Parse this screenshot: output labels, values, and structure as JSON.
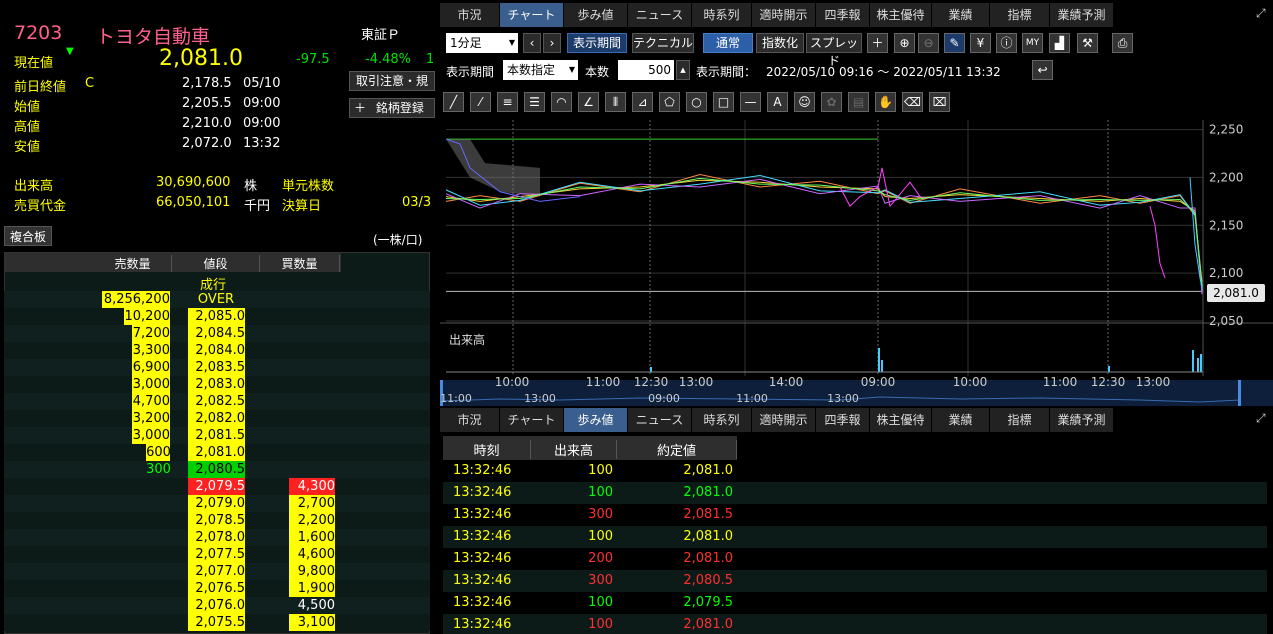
{
  "stock": {
    "code": "7203",
    "name": "トヨタ自動車",
    "market": "東証Ｐ",
    "current_label": "現在値",
    "current_price": "2,081.0",
    "change": "-97.5",
    "change_pct": "-4.48%",
    "change_trail": "1",
    "rows": [
      {
        "label": "前日終値",
        "flag": "C",
        "value": "2,178.5",
        "time": "05/10"
      },
      {
        "label": "始値",
        "value": "2,205.5",
        "time": "09:00"
      },
      {
        "label": "高値",
        "value": "2,210.0",
        "time": "09:00"
      },
      {
        "label": "安値",
        "value": "2,072.0",
        "time": "13:32"
      }
    ],
    "volume_label": "出来高",
    "volume": "30,690,600",
    "volume_unit": "株",
    "unit_shares_label": "単元株数",
    "turnover_label": "売買代金",
    "turnover": "66,050,101",
    "turnover_unit": "千円",
    "settlement_label": "決算日",
    "settlement_value": "03/3",
    "btn_notice": "取引注意・規",
    "btn_register": "銘柄登録",
    "btn_register_icon": "＋"
  },
  "orderbook": {
    "panel_label": "複合板",
    "unit_label": "(一株/口)",
    "headers": [
      "売数量",
      "値段",
      "買数量"
    ],
    "market_label": "成行",
    "rows": [
      {
        "sell": "8,256,200",
        "price": "OVER",
        "buy": "",
        "kind": "over"
      },
      {
        "sell": "10,200",
        "price": "2,085.0",
        "buy": "",
        "kind": "sell"
      },
      {
        "sell": "7,200",
        "price": "2,084.5",
        "buy": "",
        "kind": "sell"
      },
      {
        "sell": "3,300",
        "price": "2,084.0",
        "buy": "",
        "kind": "sell"
      },
      {
        "sell": "6,900",
        "price": "2,083.5",
        "buy": "",
        "kind": "sell"
      },
      {
        "sell": "3,000",
        "price": "2,083.0",
        "buy": "",
        "kind": "sell"
      },
      {
        "sell": "4,700",
        "price": "2,082.5",
        "buy": "",
        "kind": "sell"
      },
      {
        "sell": "3,200",
        "price": "2,082.0",
        "buy": "",
        "kind": "sell"
      },
      {
        "sell": "3,000",
        "price": "2,081.5",
        "buy": "",
        "kind": "sell"
      },
      {
        "sell": "600",
        "price": "2,081.0",
        "buy": "",
        "kind": "sell"
      },
      {
        "sell": "300",
        "price": "2,080.5",
        "buy": "",
        "kind": "lastsell"
      },
      {
        "sell": "",
        "price": "2,079.5",
        "buy": "4,300",
        "kind": "firstbuy"
      },
      {
        "sell": "",
        "price": "2,079.0",
        "buy": "2,700",
        "kind": "buy"
      },
      {
        "sell": "",
        "price": "2,078.5",
        "buy": "2,200",
        "kind": "buy"
      },
      {
        "sell": "",
        "price": "2,078.0",
        "buy": "1,600",
        "kind": "buy"
      },
      {
        "sell": "",
        "price": "2,077.5",
        "buy": "4,600",
        "kind": "buy"
      },
      {
        "sell": "",
        "price": "2,077.0",
        "buy": "9,800",
        "kind": "buy"
      },
      {
        "sell": "",
        "price": "2,076.5",
        "buy": "1,900",
        "kind": "buy"
      },
      {
        "sell": "",
        "price": "2,076.0",
        "buy": "4,500",
        "kind": "buyplain"
      },
      {
        "sell": "",
        "price": "2,075.5",
        "buy": "3,100",
        "kind": "buy"
      }
    ]
  },
  "tabs_top": [
    "市況",
    "チャート",
    "歩み値",
    "ニュース",
    "時系列",
    "適時開示",
    "四季報",
    "株主優待",
    "業績",
    "指標",
    "業績予測"
  ],
  "tabs_top_active": 1,
  "tabs_bottom": [
    "市況",
    "チャート",
    "歩み値",
    "ニュース",
    "時系列",
    "適時開示",
    "四季報",
    "株主優待",
    "業績",
    "指標",
    "業績予測"
  ],
  "tabs_bottom_active": 2,
  "chart_toolbar": {
    "interval": "1分足",
    "btn_period": "表示期間",
    "btn_technical": "テクニカル",
    "btn_normal": "通常",
    "btn_index": "指数化",
    "btn_spread": "スプレッド",
    "period_label": "表示期間",
    "period_mode": "本数指定",
    "count_label": "本数",
    "count_value": "500",
    "range_label": "表示期間：",
    "range_value": "2022/05/10 09:16 〜 2022/05/11 13:32"
  },
  "chart_data": {
    "type": "line",
    "y_ticks": [
      "2,250",
      "2,200",
      "2,150",
      "2,100",
      "2,050"
    ],
    "last_price_label": "2,081.0",
    "volume_label": "出来高",
    "x_ticks": [
      "10:00",
      "11:00",
      "12:30",
      "13:00",
      "14:00",
      "09:00",
      "10:00",
      "11:00",
      "12:30",
      "13:00"
    ],
    "nav_ticks": [
      "11:00",
      "13:00",
      "09:00",
      "11:00",
      "13:00"
    ],
    "ylim": [
      2050,
      2260
    ]
  },
  "ticks": {
    "headers": [
      "時刻",
      "出来高",
      "約定値"
    ],
    "rows": [
      {
        "time": "13:32:46",
        "vol": "100",
        "price": "2,081.0",
        "vc": "y",
        "pc": "y"
      },
      {
        "time": "13:32:46",
        "vol": "100",
        "price": "2,081.0",
        "vc": "g",
        "pc": "g"
      },
      {
        "time": "13:32:46",
        "vol": "300",
        "price": "2,081.5",
        "vc": "r",
        "pc": "r"
      },
      {
        "time": "13:32:46",
        "vol": "100",
        "price": "2,081.0",
        "vc": "y",
        "pc": "y"
      },
      {
        "time": "13:32:46",
        "vol": "200",
        "price": "2,081.0",
        "vc": "r",
        "pc": "r"
      },
      {
        "time": "13:32:46",
        "vol": "300",
        "price": "2,080.5",
        "vc": "r",
        "pc": "r"
      },
      {
        "time": "13:32:46",
        "vol": "100",
        "price": "2,079.5",
        "vc": "g",
        "pc": "g"
      },
      {
        "time": "13:32:46",
        "vol": "100",
        "price": "2,081.0",
        "vc": "r",
        "pc": "r"
      }
    ]
  }
}
